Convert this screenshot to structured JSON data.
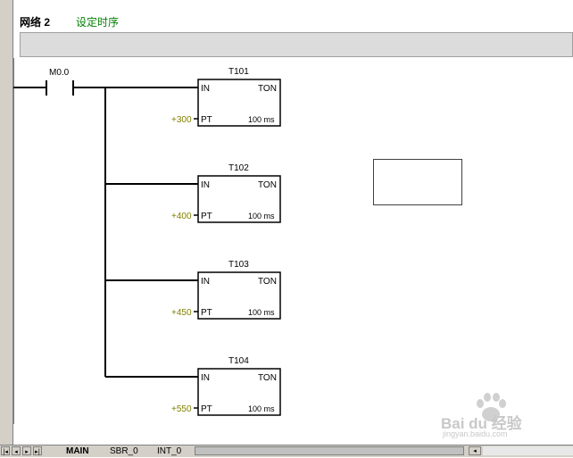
{
  "network": {
    "label": "网络 2",
    "comment": "设定时序"
  },
  "ladder": {
    "contact": {
      "address": "M0.0"
    },
    "timers": [
      {
        "name": "T101",
        "type": "TON",
        "in": "IN",
        "pt_pin": "PT",
        "preset": "+300",
        "resolution": "100 ms"
      },
      {
        "name": "T102",
        "type": "TON",
        "in": "IN",
        "pt_pin": "PT",
        "preset": "+400",
        "resolution": "100 ms"
      },
      {
        "name": "T103",
        "type": "TON",
        "in": "IN",
        "pt_pin": "PT",
        "preset": "+450",
        "resolution": "100 ms"
      },
      {
        "name": "T104",
        "type": "TON",
        "in": "IN",
        "pt_pin": "PT",
        "preset": "+550",
        "resolution": "100 ms"
      }
    ]
  },
  "tabs": [
    {
      "label": "MAIN",
      "active": true
    },
    {
      "label": "SBR_0",
      "active": false
    },
    {
      "label": "INT_0",
      "active": false
    }
  ],
  "watermark": {
    "brand": "Bai du 经验",
    "url": "jingyan.baidu.com"
  },
  "colors": {
    "preset_value": "#808000",
    "comment": "#008000",
    "wire": "#000000"
  }
}
